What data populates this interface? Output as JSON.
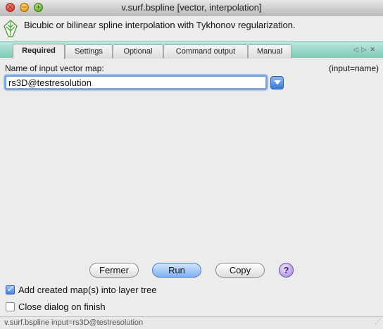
{
  "window": {
    "title": "v.surf.bspline [vector, interpolation]",
    "description": "Bicubic or bilinear spline interpolation with Tykhonov regularization."
  },
  "tabs": [
    {
      "label": "Required",
      "active": true
    },
    {
      "label": "Settings",
      "active": false
    },
    {
      "label": "Optional",
      "active": false
    },
    {
      "label": "Command output",
      "active": false
    },
    {
      "label": "Manual",
      "active": false
    }
  ],
  "tab_nav_icons": [
    "left-arrow-icon",
    "right-arrow-icon",
    "close-icon"
  ],
  "input_map": {
    "label": "Name of input vector map:",
    "param_hint": "(input=name)",
    "value": "rs3D@testresolution"
  },
  "buttons": {
    "close_label": "Fermer",
    "run_label": "Run",
    "copy_label": "Copy",
    "help_label": "?"
  },
  "options": {
    "add_to_layer_tree": {
      "label": "Add created map(s) into layer tree",
      "checked": true
    },
    "close_on_finish": {
      "label": "Close dialog on finish",
      "checked": false
    }
  },
  "statusbar": {
    "text": "v.surf.bspline input=rs3D@testresolution"
  },
  "colors": {
    "tab_strip": "#9fd9c9",
    "focus_ring": "#7aa7e6",
    "primary_button": "#7fb0f0"
  }
}
